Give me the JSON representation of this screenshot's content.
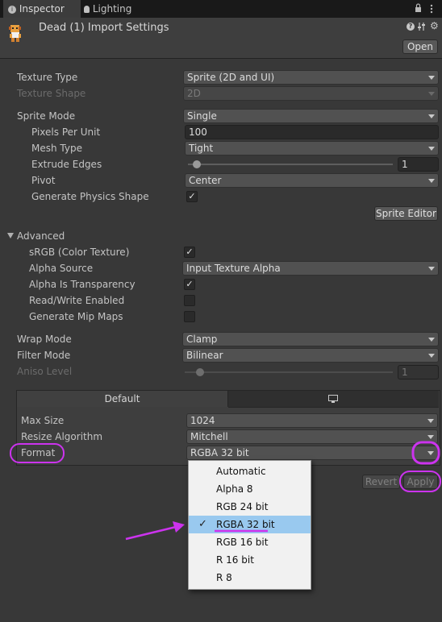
{
  "tabs": [
    {
      "label": "Inspector",
      "icon": "info-icon"
    },
    {
      "label": "Lighting",
      "icon": "bulb-icon"
    }
  ],
  "header": {
    "title": "Dead (1) Import Settings",
    "open_label": "Open"
  },
  "texture": {
    "type_label": "Texture Type",
    "type_value": "Sprite (2D and UI)",
    "shape_label": "Texture Shape",
    "shape_value": "2D"
  },
  "sprite": {
    "mode_label": "Sprite Mode",
    "mode_value": "Single",
    "ppu_label": "Pixels Per Unit",
    "ppu_value": "100",
    "mesh_label": "Mesh Type",
    "mesh_value": "Tight",
    "extrude_label": "Extrude Edges",
    "extrude_value": "1",
    "pivot_label": "Pivot",
    "pivot_value": "Center",
    "physics_label": "Generate Physics Shape",
    "editor_label": "Sprite Editor"
  },
  "advanced": {
    "title": "Advanced",
    "srgb_label": "sRGB (Color Texture)",
    "alpha_source_label": "Alpha Source",
    "alpha_source_value": "Input Texture Alpha",
    "alpha_transp_label": "Alpha Is Transparency",
    "rw_label": "Read/Write Enabled",
    "mip_label": "Generate Mip Maps"
  },
  "wrap": {
    "wrap_label": "Wrap Mode",
    "wrap_value": "Clamp",
    "filter_label": "Filter Mode",
    "filter_value": "Bilinear",
    "aniso_label": "Aniso Level",
    "aniso_value": "1"
  },
  "platform": {
    "default_tab": "Default",
    "maxsize_label": "Max Size",
    "maxsize_value": "1024",
    "resize_label": "Resize Algorithm",
    "resize_value": "Mitchell",
    "format_label": "Format",
    "format_value": "RGBA 32 bit"
  },
  "actions": {
    "revert": "Revert",
    "apply": "Apply"
  },
  "format_menu": [
    "Automatic",
    "Alpha 8",
    "RGB 24 bit",
    "RGBA 32 bit",
    "RGB 16 bit",
    "R 16 bit",
    "R 8"
  ],
  "colors": {
    "highlight": "#cc33ee",
    "menu_selected": "#99c9ef"
  }
}
